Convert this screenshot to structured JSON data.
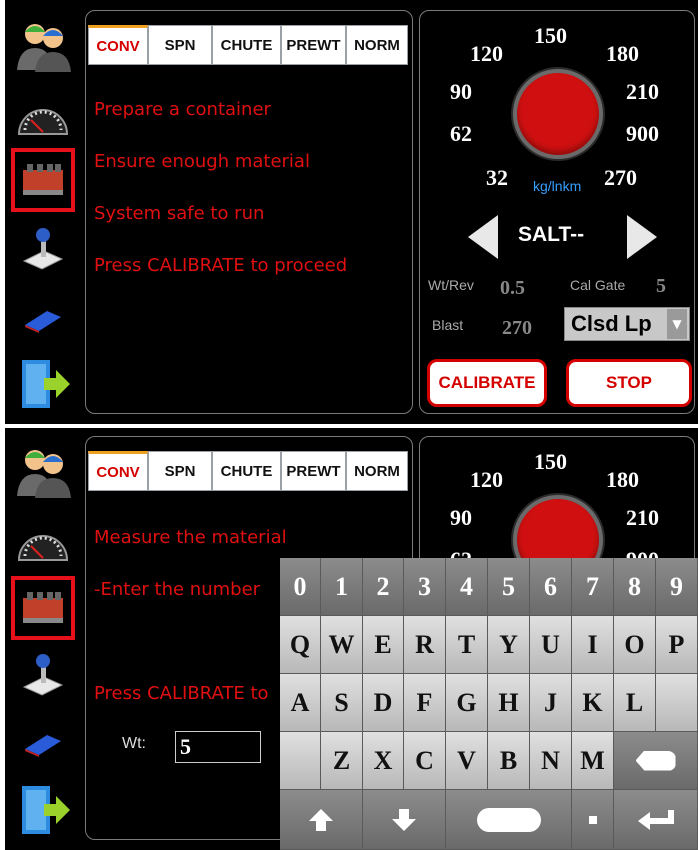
{
  "tabs": [
    "CONV",
    "SPN",
    "CHUTE",
    "PREWT",
    "NORM"
  ],
  "screen1": {
    "steps": [
      "Prepare  a container",
      "Ensure enough material",
      "System safe to run",
      "Press CALIBRATE to proceed"
    ]
  },
  "screen2": {
    "steps": [
      "Measure the material",
      "-Enter the number",
      "Press CALIBRATE to"
    ],
    "weight_label": "Wt:",
    "weight_value": "5"
  },
  "gauge": {
    "scale": {
      "s120": "120",
      "s150": "150",
      "s180": "180",
      "s90": "90",
      "s210": "210",
      "s62": "62",
      "s900": "900",
      "s32": "32",
      "s270": "270"
    },
    "unit": "kg/lnkm",
    "material": "SALT--",
    "wt_rev_label": "Wt/Rev",
    "wt_rev_value": "0.5",
    "cal_gate_label": "Cal Gate",
    "cal_gate_value": "5",
    "blast_label": "Blast",
    "blast_value": "270",
    "mode_selected": "Clsd Lp",
    "calibrate_label": "CALIBRATE",
    "stop_label": "STOP"
  },
  "keyboard": {
    "numbers": [
      "0",
      "1",
      "2",
      "3",
      "4",
      "5",
      "6",
      "7",
      "8",
      "9"
    ],
    "row1": [
      "Q",
      "W",
      "E",
      "R",
      "T",
      "Y",
      "U",
      "I",
      "O",
      "P"
    ],
    "row2": [
      "A",
      "S",
      "D",
      "F",
      "G",
      "H",
      "J",
      "K",
      "L"
    ],
    "row3": [
      "Z",
      "X",
      "C",
      "V",
      "B",
      "N",
      "M"
    ]
  },
  "colors": {
    "accent_red": "#d40000",
    "unit_blue": "#33a0ff",
    "tab_highlight": "#f0a020"
  },
  "icons": [
    "users-icon",
    "speedometer-icon",
    "valve-manifold-icon",
    "joystick-icon",
    "usb-drive-icon",
    "exit-door-icon"
  ]
}
